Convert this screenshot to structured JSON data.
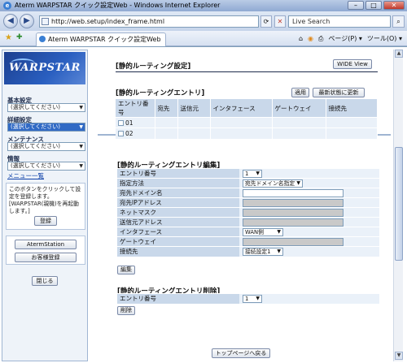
{
  "window": {
    "title": "Aterm WARPSTAR クイック設定Web - Windows Internet Explorer",
    "controls": {
      "minimize": "–",
      "maximize": "□",
      "close": "✕"
    }
  },
  "address_bar": {
    "url": "http://web.setup/index_frame.html",
    "search_placeholder": "Live Search"
  },
  "tabbar": {
    "tab_title": "Aterm WARPSTAR クイック設定Web",
    "page_menu": "ページ(P) ▾",
    "tools_menu": "ツール(O) ▾"
  },
  "sidebar": {
    "logo_text": "WARPSTAR",
    "groups": [
      {
        "label": "基本設定",
        "value": "(選択してください)"
      },
      {
        "label": "詳細設定",
        "value": "(選択してください)"
      },
      {
        "label": "メンテナンス",
        "value": "(選択してください)"
      },
      {
        "label": "情報",
        "value": "(選択してください)"
      }
    ],
    "menu_link": "メニュー一覧",
    "register_note": "このボタンをクリックして設定を登録します。[WARPSTAR(親機)を再起動します。]",
    "register_button": "登録",
    "aterm_station_button": "AtermStation",
    "customer_register_button": "お客様登録",
    "close_button": "閉じる"
  },
  "top_panel": {
    "title": "[静的ルーティング設定]",
    "wide_view_button": "WIDE View",
    "entries_title": "[静的ルーティングエントリ]",
    "apply_button": "適用",
    "refresh_button": "最新状態に更新",
    "columns": [
      "エントリ番号",
      "宛先",
      "送信元",
      "インタフェース",
      "ゲートウェイ",
      "接続先"
    ],
    "rows": [
      {
        "entry": "01"
      },
      {
        "entry": "02"
      }
    ]
  },
  "edit_panel": {
    "title": "[静的ルーティングエントリ編集]",
    "fields": {
      "entry_number": {
        "label": "エントリ番号",
        "value": "1"
      },
      "method": {
        "label": "指定方法",
        "value": "宛先ドメイン名指定"
      },
      "domain": {
        "label": "宛先ドメイン名",
        "value": ""
      },
      "dest_ip": {
        "label": "宛先IPアドレス",
        "value": ""
      },
      "netmask": {
        "label": "ネットマスク",
        "value": ""
      },
      "src_addr": {
        "label": "送信元アドレス",
        "value": ""
      },
      "interface": {
        "label": "インタフェース",
        "value": "WAN側"
      },
      "gateway": {
        "label": "ゲートウェイ",
        "value": ""
      },
      "connection": {
        "label": "接続先",
        "value": "接続設定1"
      }
    },
    "edit_button": "編集"
  },
  "delete_panel": {
    "title": "[静的ルーティングエントリ削除]",
    "entry_label": "エントリ番号",
    "entry_value": "1",
    "delete_button": "削除"
  },
  "top_page_button": "トップページへ戻る"
}
